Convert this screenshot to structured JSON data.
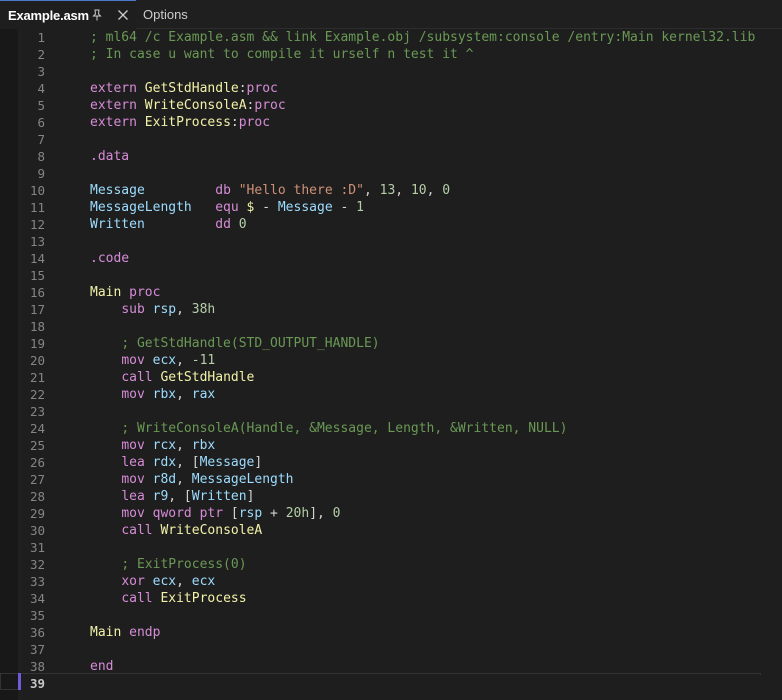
{
  "tabs": [
    {
      "label": "Example.asm",
      "active": true,
      "pinned": true
    },
    {
      "label": "Options",
      "active": false
    }
  ],
  "icons": {
    "pin": "pin-icon",
    "close": "close-icon"
  },
  "colors": {
    "comment": "#6a9955",
    "keyword": "#d68cd6",
    "identifier": "#f2f2a8",
    "variable": "#9cdcfe",
    "string": "#ce9178",
    "number": "#b5cea8",
    "accent": "#4d78cc"
  },
  "editor": {
    "current_line": 39,
    "lines": [
      {
        "n": "1",
        "tokens": [
          [
            "c",
            "; ml64 /c Example.asm && link Example.obj /subsystem:console /entry:Main kernel32.lib"
          ]
        ]
      },
      {
        "n": "2",
        "tokens": [
          [
            "c",
            "; In case u want to compile it urself n test it ^"
          ]
        ]
      },
      {
        "n": "3",
        "tokens": []
      },
      {
        "n": "4",
        "tokens": [
          [
            "k",
            "extern "
          ],
          [
            "i",
            "GetStdHandle"
          ],
          [
            "p",
            ":"
          ],
          [
            "k",
            "proc"
          ]
        ]
      },
      {
        "n": "5",
        "tokens": [
          [
            "k",
            "extern "
          ],
          [
            "i",
            "WriteConsoleA"
          ],
          [
            "p",
            ":"
          ],
          [
            "k",
            "proc"
          ]
        ]
      },
      {
        "n": "6",
        "tokens": [
          [
            "k",
            "extern "
          ],
          [
            "i",
            "ExitProcess"
          ],
          [
            "p",
            ":"
          ],
          [
            "k",
            "proc"
          ]
        ]
      },
      {
        "n": "7",
        "tokens": []
      },
      {
        "n": "8",
        "tokens": [
          [
            "k",
            ".data"
          ]
        ]
      },
      {
        "n": "9",
        "tokens": []
      },
      {
        "n": "10",
        "tokens": [
          [
            "v",
            "Message"
          ],
          [
            "p",
            "         "
          ],
          [
            "k",
            "db "
          ],
          [
            "s",
            "\"Hello there :D\""
          ],
          [
            "p",
            ", "
          ],
          [
            "n",
            "13"
          ],
          [
            "p",
            ", "
          ],
          [
            "n",
            "10"
          ],
          [
            "p",
            ", "
          ],
          [
            "n",
            "0"
          ]
        ]
      },
      {
        "n": "11",
        "tokens": [
          [
            "v",
            "MessageLength"
          ],
          [
            "p",
            "   "
          ],
          [
            "k",
            "equ "
          ],
          [
            "i",
            "$"
          ],
          [
            "p",
            " - "
          ],
          [
            "v",
            "Message"
          ],
          [
            "p",
            " - "
          ],
          [
            "n",
            "1"
          ]
        ]
      },
      {
        "n": "12",
        "tokens": [
          [
            "v",
            "Written"
          ],
          [
            "p",
            "         "
          ],
          [
            "k",
            "dd "
          ],
          [
            "n",
            "0"
          ]
        ]
      },
      {
        "n": "13",
        "tokens": []
      },
      {
        "n": "14",
        "tokens": [
          [
            "k",
            ".code"
          ]
        ]
      },
      {
        "n": "15",
        "tokens": []
      },
      {
        "n": "16",
        "tokens": [
          [
            "i",
            "Main"
          ],
          [
            "p",
            " "
          ],
          [
            "k",
            "proc"
          ]
        ]
      },
      {
        "n": "17",
        "tokens": [
          [
            "p",
            "    "
          ],
          [
            "k",
            "sub "
          ],
          [
            "v",
            "rsp"
          ],
          [
            "p",
            ", "
          ],
          [
            "n",
            "38h"
          ]
        ]
      },
      {
        "n": "18",
        "tokens": []
      },
      {
        "n": "19",
        "tokens": [
          [
            "p",
            "    "
          ],
          [
            "c",
            "; GetStdHandle(STD_OUTPUT_HANDLE)"
          ]
        ]
      },
      {
        "n": "20",
        "tokens": [
          [
            "p",
            "    "
          ],
          [
            "k",
            "mov "
          ],
          [
            "v",
            "ecx"
          ],
          [
            "p",
            ", "
          ],
          [
            "n",
            "-11"
          ]
        ]
      },
      {
        "n": "21",
        "tokens": [
          [
            "p",
            "    "
          ],
          [
            "k",
            "call "
          ],
          [
            "i",
            "GetStdHandle"
          ]
        ]
      },
      {
        "n": "22",
        "tokens": [
          [
            "p",
            "    "
          ],
          [
            "k",
            "mov "
          ],
          [
            "v",
            "rbx"
          ],
          [
            "p",
            ", "
          ],
          [
            "v",
            "rax"
          ]
        ]
      },
      {
        "n": "23",
        "tokens": []
      },
      {
        "n": "24",
        "tokens": [
          [
            "p",
            "    "
          ],
          [
            "c",
            "; WriteConsoleA(Handle, &Message, Length, &Written, NULL)"
          ]
        ]
      },
      {
        "n": "25",
        "tokens": [
          [
            "p",
            "    "
          ],
          [
            "k",
            "mov "
          ],
          [
            "v",
            "rcx"
          ],
          [
            "p",
            ", "
          ],
          [
            "v",
            "rbx"
          ]
        ]
      },
      {
        "n": "26",
        "tokens": [
          [
            "p",
            "    "
          ],
          [
            "k",
            "lea "
          ],
          [
            "v",
            "rdx"
          ],
          [
            "p",
            ", ["
          ],
          [
            "v",
            "Message"
          ],
          [
            "p",
            "]"
          ]
        ]
      },
      {
        "n": "27",
        "tokens": [
          [
            "p",
            "    "
          ],
          [
            "k",
            "mov "
          ],
          [
            "v",
            "r8d"
          ],
          [
            "p",
            ", "
          ],
          [
            "v",
            "MessageLength"
          ]
        ]
      },
      {
        "n": "28",
        "tokens": [
          [
            "p",
            "    "
          ],
          [
            "k",
            "lea "
          ],
          [
            "v",
            "r9"
          ],
          [
            "p",
            ", ["
          ],
          [
            "v",
            "Written"
          ],
          [
            "p",
            "]"
          ]
        ]
      },
      {
        "n": "29",
        "tokens": [
          [
            "p",
            "    "
          ],
          [
            "k",
            "mov "
          ],
          [
            "k",
            "qword ptr "
          ],
          [
            "p",
            "["
          ],
          [
            "v",
            "rsp"
          ],
          [
            "p",
            " + "
          ],
          [
            "n",
            "20h"
          ],
          [
            "p",
            "], "
          ],
          [
            "n",
            "0"
          ]
        ]
      },
      {
        "n": "30",
        "tokens": [
          [
            "p",
            "    "
          ],
          [
            "k",
            "call "
          ],
          [
            "i",
            "WriteConsoleA"
          ]
        ]
      },
      {
        "n": "31",
        "tokens": []
      },
      {
        "n": "32",
        "tokens": [
          [
            "p",
            "    "
          ],
          [
            "c",
            "; ExitProcess(0)"
          ]
        ]
      },
      {
        "n": "33",
        "tokens": [
          [
            "p",
            "    "
          ],
          [
            "k",
            "xor "
          ],
          [
            "v",
            "ecx"
          ],
          [
            "p",
            ", "
          ],
          [
            "v",
            "ecx"
          ]
        ]
      },
      {
        "n": "34",
        "tokens": [
          [
            "p",
            "    "
          ],
          [
            "k",
            "call "
          ],
          [
            "i",
            "ExitProcess"
          ]
        ]
      },
      {
        "n": "35",
        "tokens": []
      },
      {
        "n": "36",
        "tokens": [
          [
            "i",
            "Main"
          ],
          [
            "p",
            " "
          ],
          [
            "k",
            "endp"
          ]
        ]
      },
      {
        "n": "37",
        "tokens": []
      },
      {
        "n": "38",
        "tokens": [
          [
            "k",
            "end"
          ]
        ]
      },
      {
        "n": "39",
        "tokens": []
      }
    ]
  }
}
